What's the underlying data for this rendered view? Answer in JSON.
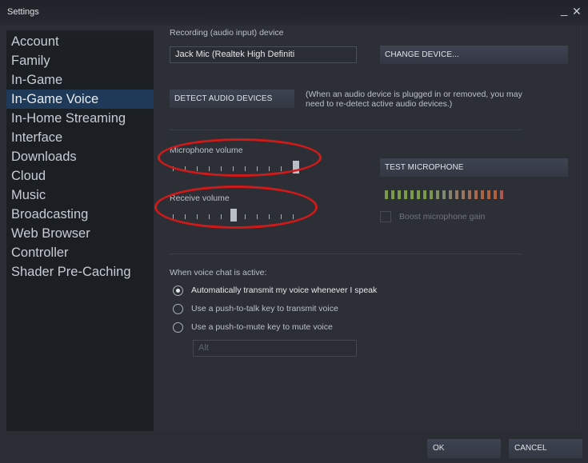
{
  "window": {
    "title": "Settings",
    "minimize_glyph": "_",
    "close_glyph": "✕"
  },
  "sidebar": {
    "active_index": 3,
    "items": [
      {
        "label": "Account"
      },
      {
        "label": "Family"
      },
      {
        "label": "In-Game"
      },
      {
        "label": "In-Game Voice"
      },
      {
        "label": "In-Home Streaming"
      },
      {
        "label": "Interface"
      },
      {
        "label": "Downloads"
      },
      {
        "label": "Cloud"
      },
      {
        "label": "Music"
      },
      {
        "label": "Broadcasting"
      },
      {
        "label": "Web Browser"
      },
      {
        "label": "Controller"
      },
      {
        "label": "Shader Pre-Caching"
      }
    ]
  },
  "recording": {
    "label": "Recording (audio input) device",
    "device_value": "Jack Mic (Realtek High Definiti",
    "change_device_label": "CHANGE DEVICE...",
    "detect_label": "DETECT AUDIO DEVICES",
    "detect_note_line1": "(When an audio device is plugged in or removed, you may",
    "detect_note_line2": "need to re-detect active audio devices.)"
  },
  "microphone_volume": {
    "label": "Microphone volume",
    "value_fraction": 1.0,
    "tick_count": 11
  },
  "receive_volume": {
    "label": "Receive volume",
    "value_fraction": 0.5,
    "tick_count": 11
  },
  "test_microphone": {
    "label": "TEST MICROPHONE",
    "meter_segments": 19,
    "meter_colors": [
      "#7b9a4a",
      "#7b9a4a",
      "#7b9a4a",
      "#7b9a4a",
      "#7b9a4a",
      "#7b9a4a",
      "#7b9a4a",
      "#7c9450",
      "#7d8c62",
      "#7f8870",
      "#878070",
      "#8f7a68",
      "#977460",
      "#9f6e56",
      "#a76a4e",
      "#a96446",
      "#ad6242",
      "#b36040",
      "#a95a50"
    ]
  },
  "boost_gain": {
    "label": "Boost microphone gain",
    "checked": false
  },
  "voice_chat": {
    "heading": "When voice chat is active:",
    "selected_index": 0,
    "options": [
      {
        "label": "Automatically transmit my voice whenever I speak"
      },
      {
        "label": "Use a push-to-talk key to transmit voice"
      },
      {
        "label": "Use a push-to-mute key to mute voice"
      }
    ],
    "key_value": "Alt"
  },
  "footer": {
    "ok_label": "OK",
    "cancel_label": "CANCEL"
  },
  "colors": {
    "annotation": "#d01a1a",
    "active_nav": "#1f3a58"
  }
}
